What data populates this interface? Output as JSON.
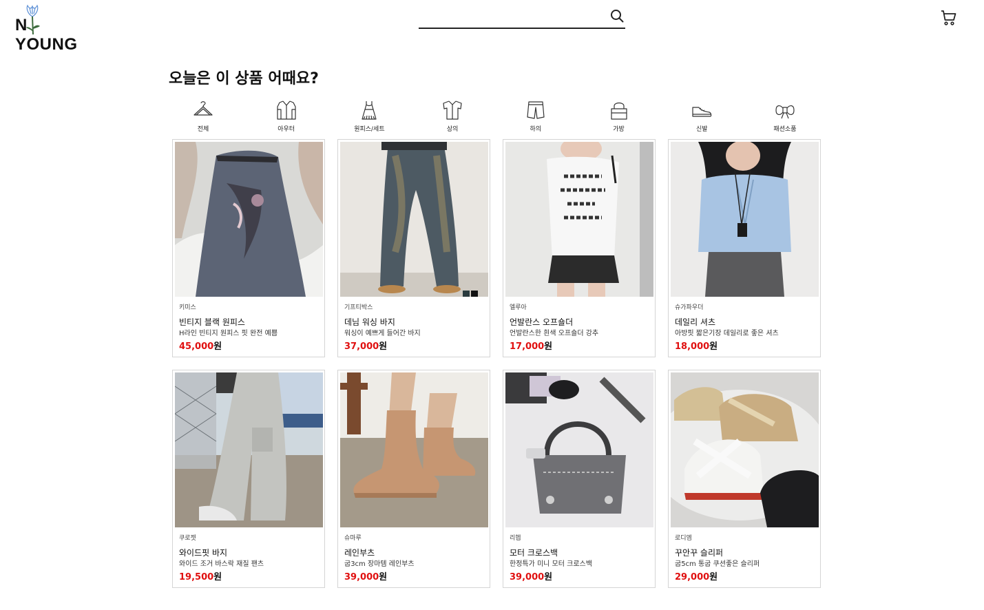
{
  "header": {
    "logo_text_left": "N",
    "logo_text_right": "YOUNG",
    "search": {
      "value": "",
      "placeholder": ""
    }
  },
  "section_title": "오늘은 이 상품 어때요?",
  "categories": [
    {
      "label": "전체",
      "icon": "hanger-icon"
    },
    {
      "label": "아우터",
      "icon": "jacket-icon"
    },
    {
      "label": "원피스/세트",
      "icon": "dress-icon"
    },
    {
      "label": "상의",
      "icon": "shirt-icon"
    },
    {
      "label": "하의",
      "icon": "shorts-icon"
    },
    {
      "label": "가방",
      "icon": "bag-icon"
    },
    {
      "label": "신발",
      "icon": "sneaker-icon"
    },
    {
      "label": "패션소품",
      "icon": "bow-icon"
    }
  ],
  "products": [
    {
      "brand": "키미스",
      "name": "빈티지 블랙 원피스",
      "desc": "H라인 빈티지 원피스 핏 완전 예쁨",
      "price": "45,000",
      "unit": "원"
    },
    {
      "brand": "기프티박스",
      "name": "데님 워싱 바지",
      "desc": "워싱이 예쁘게 들어간 바지",
      "price": "37,000",
      "unit": "원"
    },
    {
      "brand": "엘루아",
      "name": "언발란스 오프숄더",
      "desc": "언발란스한 흰색 오프숄더 강추",
      "price": "17,000",
      "unit": "원"
    },
    {
      "brand": "슈가파우더",
      "name": "데일리 셔츠",
      "desc": "아방핏 짧은기장 데일리로 좋은 셔츠",
      "price": "18,000",
      "unit": "원"
    },
    {
      "brand": "쿠로젯",
      "name": "와이드핏 바지",
      "desc": "와이드 조거 바스락 재질 팬츠",
      "price": "19,500",
      "unit": "원"
    },
    {
      "brand": "슈마루",
      "name": "레인부츠",
      "desc": "굽3cm 장마템 레인부츠",
      "price": "39,000",
      "unit": "원"
    },
    {
      "brand": "리헵",
      "name": "모터 크로스백",
      "desc": "한정특가 미니 모터 크로스백",
      "price": "39,000",
      "unit": "원"
    },
    {
      "brand": "로디엠",
      "name": "꾸안꾸 슬리퍼",
      "desc": "굽5cm 통굽 쿠션좋은 슬리퍼",
      "price": "29,000",
      "unit": "원"
    }
  ]
}
